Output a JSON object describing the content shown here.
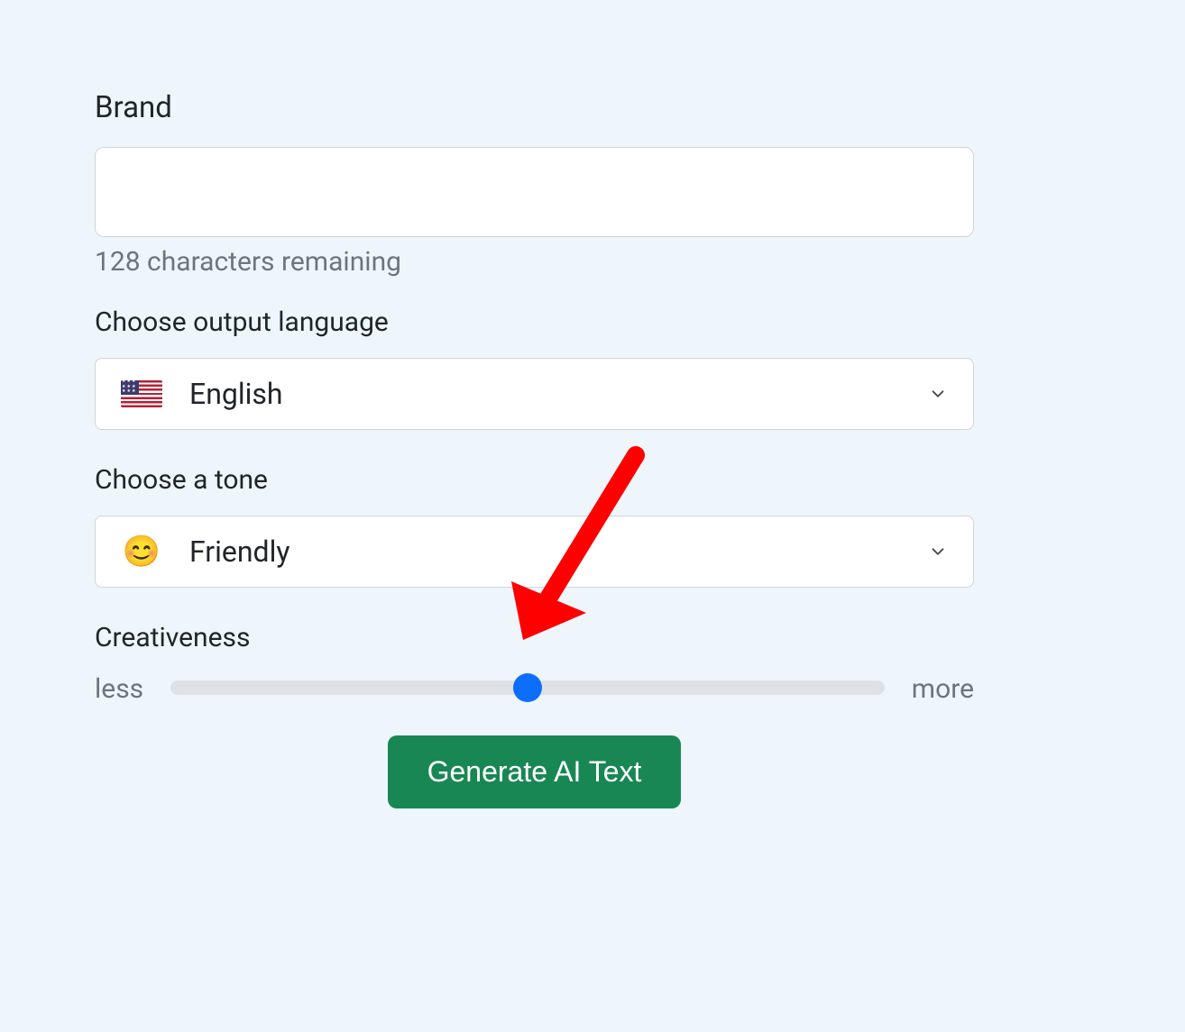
{
  "brand": {
    "label": "Brand",
    "value": "",
    "remaining_text": "128 characters remaining"
  },
  "language": {
    "label": "Choose output language",
    "selected": "English",
    "flag": "us"
  },
  "tone": {
    "label": "Choose a tone",
    "selected": "Friendly",
    "emoji": "😊"
  },
  "creativeness": {
    "label": "Creativeness",
    "min_label": "less",
    "max_label": "more",
    "min": 0,
    "max": 100,
    "value": 50
  },
  "actions": {
    "generate_label": "Generate AI Text"
  },
  "annotation": {
    "type": "arrow",
    "color": "#ff0000",
    "target": "creativeness-slider-thumb"
  }
}
